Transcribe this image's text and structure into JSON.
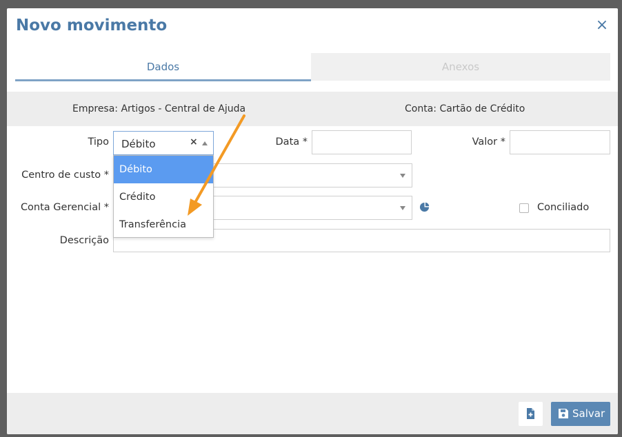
{
  "modal": {
    "title": "Novo movimento",
    "close_icon": "×"
  },
  "tabs": [
    {
      "label": "Dados",
      "active": true
    },
    {
      "label": "Anexos",
      "active": false
    }
  ],
  "info": {
    "empresa": "Empresa: Artigos - Central de Ajuda",
    "conta": "Conta: Cartão de Crédito"
  },
  "form": {
    "tipo_label": "Tipo",
    "tipo_value": "Débito",
    "tipo_clear": "×",
    "tipo_options": [
      "Débito",
      "Crédito",
      "Transferência"
    ],
    "data_label": "Data *",
    "data_value": "",
    "valor_label": "Valor *",
    "valor_value": "",
    "centro_label": "Centro de custo *",
    "conta_gerencial_label": "Conta Gerencial *",
    "conciliado_label": "Conciliado",
    "conciliado_checked": false,
    "descricao_label": "Descrição",
    "descricao_value": ""
  },
  "footer": {
    "save_label": "Salvar"
  },
  "icons": {
    "pie": "pie-chart-icon",
    "doc": "add-document-icon",
    "save": "floppy-disk-icon",
    "annotation": "orange-arrow"
  },
  "colors": {
    "accent": "#4a79a6",
    "selected_option": "#5b9bf0",
    "save_button": "#5b88b4",
    "annotation_arrow": "#f39a24"
  }
}
